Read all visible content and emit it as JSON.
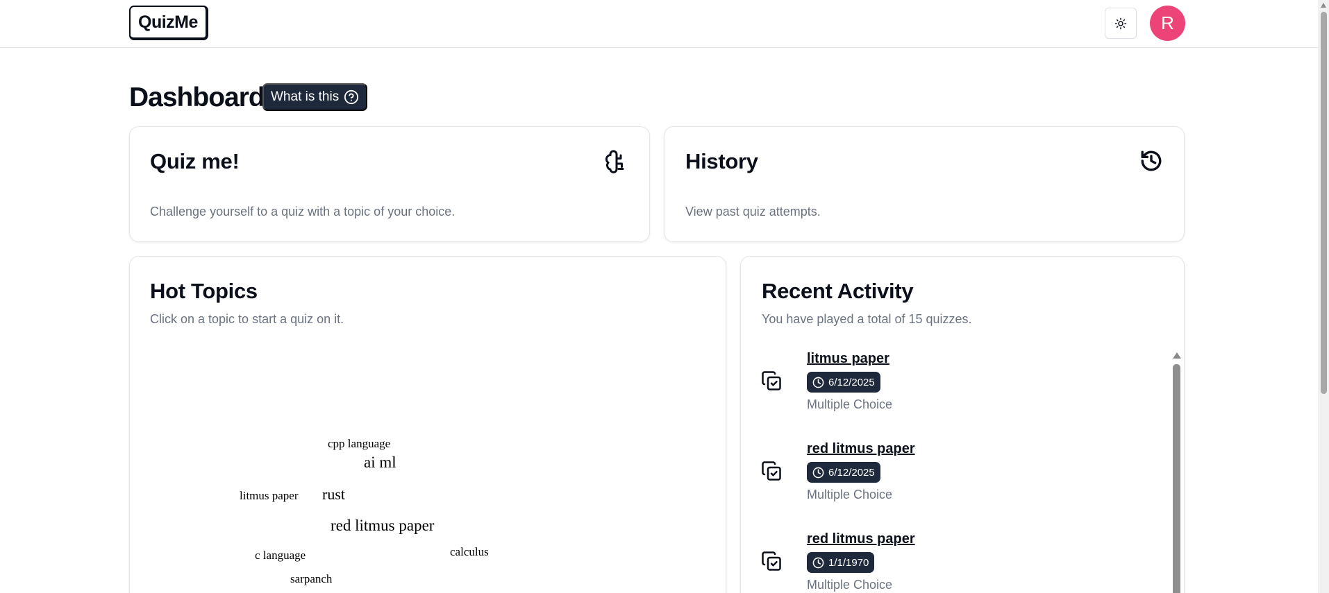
{
  "app": {
    "logo": "QuizMe",
    "avatar_initial": "R"
  },
  "icons": {
    "theme": "sun-icon",
    "help": "question-circle-icon",
    "quiz": "brain-icon",
    "history": "history-icon",
    "activity": "copy-check-icon",
    "clock": "clock-icon"
  },
  "colors": {
    "avatar": "#ec4479",
    "badge": "#1e293b"
  },
  "page": {
    "title": "Dashboard",
    "help_label": "What is this"
  },
  "quiz_card": {
    "title": "Quiz me!",
    "description": "Challenge yourself to a quiz with a topic of your choice."
  },
  "history_card": {
    "title": "History",
    "description": "View past quiz attempts."
  },
  "hot_topics": {
    "title": "Hot Topics",
    "subtitle": "Click on a topic to start a quiz on it.",
    "words": [
      "cpp language",
      "ai ml",
      "litmus paper",
      "rust",
      "red litmus paper",
      "c language",
      "calculus",
      "sarpanch"
    ]
  },
  "recent_activity": {
    "title": "Recent Activity",
    "subtitle": "You have played a total of 15 quizzes.",
    "items": [
      {
        "title": "litmus paper",
        "date": "6/12/2025",
        "type": "Multiple Choice"
      },
      {
        "title": "red litmus paper",
        "date": "6/12/2025",
        "type": "Multiple Choice"
      },
      {
        "title": "red litmus paper",
        "date": "1/1/1970",
        "type": "Multiple Choice"
      }
    ]
  }
}
